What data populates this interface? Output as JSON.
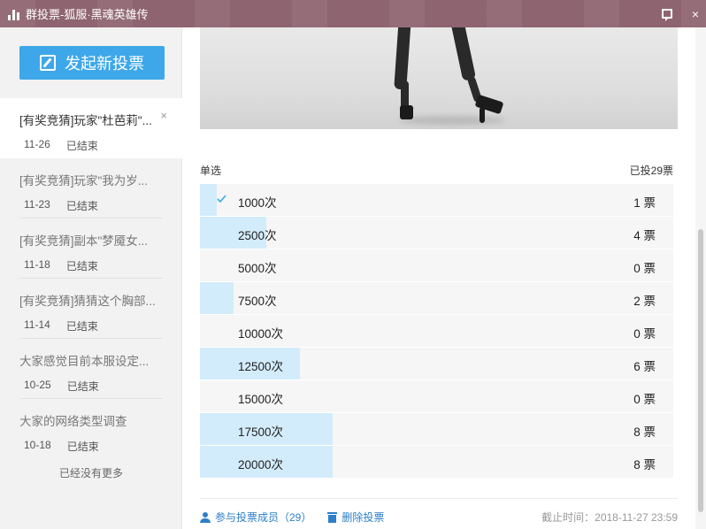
{
  "window": {
    "title": "群投票-狐服·黑魂英雄传",
    "buttons": {
      "feedback": "feedback-icon",
      "close": "×"
    },
    "titlebar_color": "#8e6470"
  },
  "sidebar": {
    "new_vote_label": "发起新投票",
    "items": [
      {
        "title": "[有奖竞猜]玩家\"杜芭莉\"...",
        "date": "11-26",
        "status": "已结束",
        "active": true
      },
      {
        "title": "[有奖竞猜]玩家\"我为岁...",
        "date": "11-23",
        "status": "已结束"
      },
      {
        "title": "[有奖竞猜]副本\"梦魇女...",
        "date": "11-18",
        "status": "已结束"
      },
      {
        "title": "[有奖竞猜]猜猜这个胸部...",
        "date": "11-14",
        "status": "已结束"
      },
      {
        "title": "大家感觉目前本服设定...",
        "date": "10-25",
        "status": "已结束"
      },
      {
        "title": "大家的网络类型调查",
        "date": "10-18",
        "status": "已结束"
      }
    ],
    "no_more": "已经没有更多",
    "close_icon": "×"
  },
  "vote": {
    "type_label": "单选",
    "total_label": "已投29票",
    "total_votes": 29,
    "max_votes": 8,
    "options": [
      {
        "label": "1000次",
        "votes": 1,
        "count_label": "1 票",
        "selected": true
      },
      {
        "label": "2500次",
        "votes": 4,
        "count_label": "4 票"
      },
      {
        "label": "5000次",
        "votes": 0,
        "count_label": "0 票"
      },
      {
        "label": "7500次",
        "votes": 2,
        "count_label": "2 票"
      },
      {
        "label": "10000次",
        "votes": 0,
        "count_label": "0 票"
      },
      {
        "label": "12500次",
        "votes": 6,
        "count_label": "6 票"
      },
      {
        "label": "15000次",
        "votes": 0,
        "count_label": "0 票"
      },
      {
        "label": "17500次",
        "votes": 8,
        "count_label": "8 票"
      },
      {
        "label": "20000次",
        "votes": 8,
        "count_label": "8 票"
      }
    ],
    "bar_color": "#d3ecfb"
  },
  "footer": {
    "members_label": "参与投票成员（29）",
    "delete_label": "删除投票",
    "deadline": "截止时间：2018-11-27 23:59"
  },
  "colors": {
    "accent": "#3ea7e9",
    "link": "#2d7fc8"
  }
}
